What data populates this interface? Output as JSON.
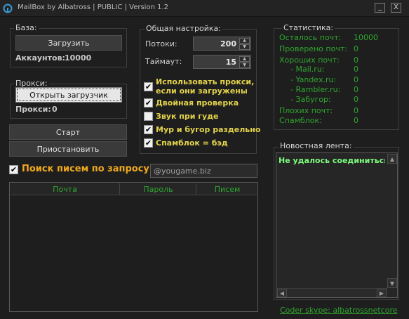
{
  "window": {
    "title": "MailBox by Albatross | PUBLIC | Version 1.2",
    "minimize_label": "_",
    "close_label": "X"
  },
  "base": {
    "title": "База:",
    "load_button": "Загрузить",
    "accounts_label": "Аккаунтов:",
    "accounts_value": "10000"
  },
  "proxy": {
    "title": "Прокси:",
    "open_loader_button": "Открыть загрузчик",
    "proxy_label": "Прокси:",
    "proxy_value": "0"
  },
  "controls": {
    "start_button": "Старт",
    "pause_button": "Приостановить"
  },
  "settings": {
    "title": "Общая настройка:",
    "threads_label": "Потоки:",
    "threads_value": "200",
    "timeout_label": "Таймаут:",
    "timeout_value": "15",
    "options": [
      {
        "label": "Использовать прокси, если они загружены",
        "checked": true
      },
      {
        "label": "Двойная проверка",
        "checked": true
      },
      {
        "label": "Звук при гуде",
        "checked": false
      },
      {
        "label": "Мур и бугор раздельно",
        "checked": true
      },
      {
        "label": "Спамблок = бэд",
        "checked": true
      }
    ]
  },
  "stats": {
    "title": "Статистика:",
    "rows": [
      {
        "label": "Осталось почт:",
        "value": "10000"
      },
      {
        "label": "Проверено почт:",
        "value": "0"
      },
      {
        "label": "Хороших почт:",
        "value": "0"
      },
      {
        "label": "- Mail.ru:",
        "value": "0"
      },
      {
        "label": "- Yandex.ru:",
        "value": "0"
      },
      {
        "label": "- Rambler.ru:",
        "value": "0"
      },
      {
        "label": "- Забугор:",
        "value": "0"
      },
      {
        "label": "Плохих почт:",
        "value": "0"
      },
      {
        "label": "Спамблок:",
        "value": "0"
      }
    ]
  },
  "search": {
    "checked": true,
    "label": "Поиск писем по запросу:",
    "query": "@yougame.biz"
  },
  "results_table": {
    "columns": [
      "Почта",
      "Пароль",
      "Писем"
    ]
  },
  "news": {
    "title": "Новостная лента:",
    "message": "Не удалось соединиться с сервером"
  },
  "footer": {
    "coder_link": "Coder skype: albatrossnetcore"
  },
  "colors": {
    "background": "#1e1e1e",
    "stat_green": "#2fa62f",
    "checkbox_label_yellow": "#e3d34b",
    "search_label_orange": "#f0a81e",
    "news_text_green": "#7dfc7d"
  }
}
